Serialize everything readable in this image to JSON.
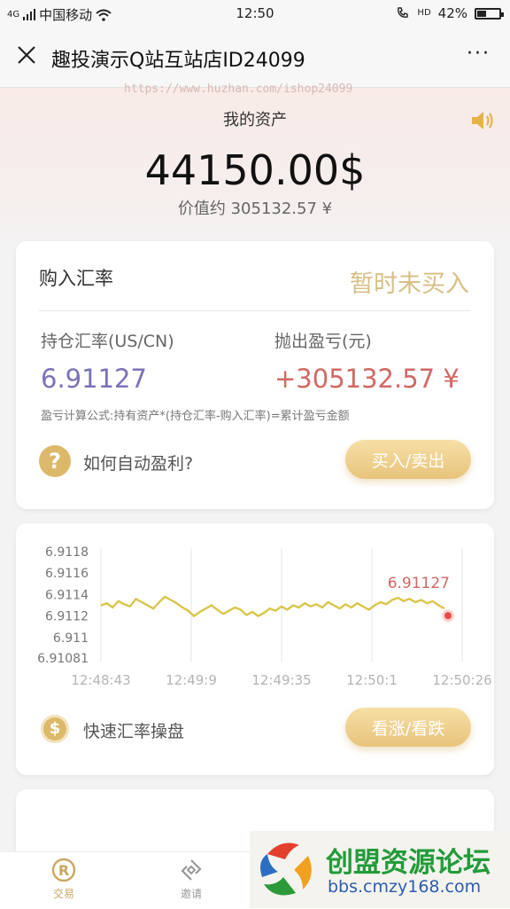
{
  "status_bar": {
    "network": "4G",
    "carrier": "中国移动",
    "time": "12:50",
    "hd": "HD",
    "battery_text": "42%",
    "battery_level": 0.42
  },
  "nav": {
    "title": "趣投演示Q站互站店ID24099",
    "more": "···"
  },
  "header": {
    "watermark": "https://www.huzhan.com/ishop24099",
    "assets_label": "我的资产",
    "assets_amount": "44150.00$",
    "assets_value": "价值约 305132.57 ¥"
  },
  "rate_card": {
    "buy_rate_label": "购入汇率",
    "buy_status": "暂时未买入",
    "hold_rate_label": "持仓汇率(US/CN)",
    "pl_label": "抛出盈亏(元)",
    "hold_rate_value": "6.91127",
    "pl_value": "+305132.57 ¥",
    "formula": "盈亏计算公式:持有资产*(持仓汇率-购入汇率)=累计盈亏金额",
    "help_icon": "?",
    "help_text": "如何自动盈利?",
    "trade_button": "买入/卖出"
  },
  "chart_card": {
    "coin_icon": "$",
    "quick_text": "快速汇率操盘",
    "updown_button": "看涨/看跌"
  },
  "chart_data": {
    "type": "line",
    "x_ticks": [
      "12:48:43",
      "12:49:9",
      "12:49:35",
      "12:50:1",
      "12:50:26"
    ],
    "y_ticks": [
      "6.9118",
      "6.9116",
      "6.9114",
      "6.9112",
      "6.911",
      "6.91081"
    ],
    "ylim": [
      6.91081,
      6.9118
    ],
    "last_value_label": "6.91127",
    "color": "#d9c64a",
    "values": [
      6.9113,
      6.91132,
      6.91128,
      6.91134,
      6.91131,
      6.91129,
      6.91136,
      6.91133,
      6.9113,
      6.91127,
      6.91133,
      6.91138,
      6.91135,
      6.91132,
      6.91128,
      6.91125,
      6.9112,
      6.91124,
      6.91127,
      6.9113,
      6.91126,
      6.91122,
      6.91125,
      6.91128,
      6.91126,
      6.91121,
      6.91124,
      6.9112,
      6.91123,
      6.91127,
      6.91125,
      6.91129,
      6.91126,
      6.9113,
      6.91128,
      6.91132,
      6.91129,
      6.91131,
      6.91128,
      6.91133,
      6.9113,
      6.91127,
      6.91131,
      6.91128,
      6.91132,
      6.91129,
      6.91126,
      6.9113,
      6.91133,
      6.91131,
      6.91135,
      6.91137,
      6.91134,
      6.91136,
      6.91133,
      6.91135,
      6.91132,
      6.91134,
      6.9113,
      6.91127
    ]
  },
  "tabbar": {
    "tabs": [
      {
        "label": "交易",
        "icon": "registered-icon",
        "active": true
      },
      {
        "label": "邀请",
        "icon": "link-icon",
        "active": false
      }
    ]
  },
  "ad": {
    "name": "创盟资源论坛",
    "url": "bbs.cmzy168.com"
  },
  "colors": {
    "gold": "#dcb96a",
    "purple_value": "#7a73b8",
    "red_value": "#d26863",
    "chart_marker": "#e84a4a"
  }
}
